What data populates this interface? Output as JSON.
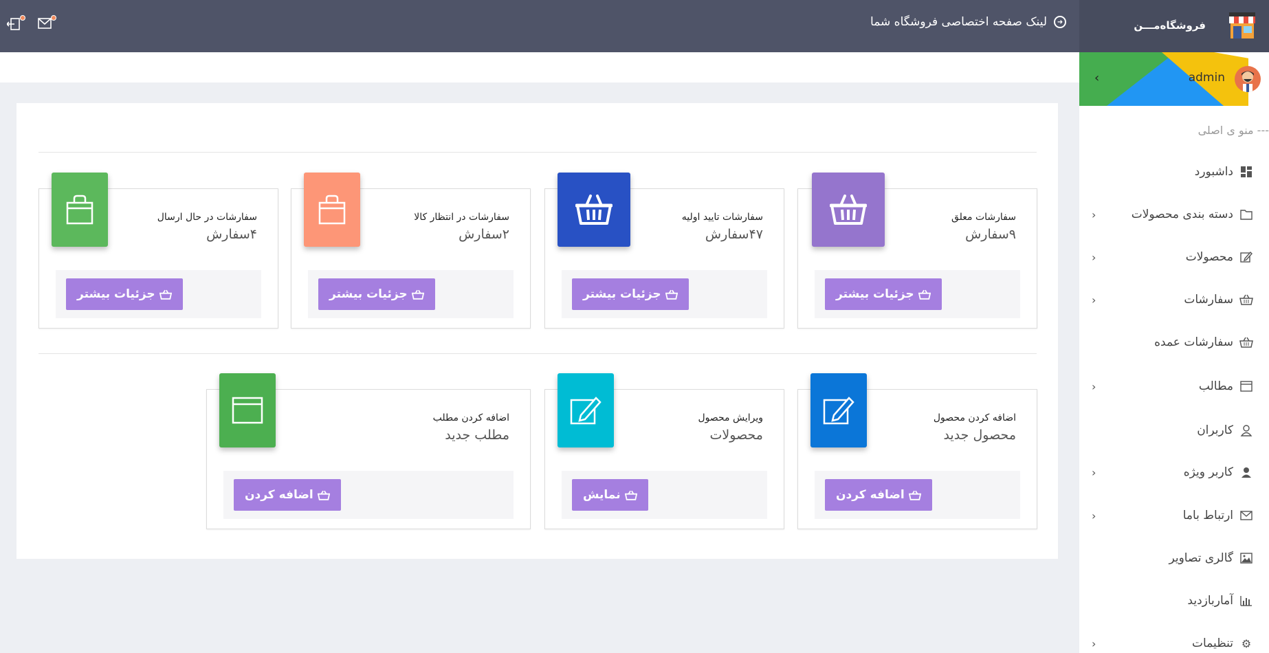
{
  "header": {
    "logo_text": "فروشگاه‌مـــن",
    "store_link_label": "لینک صفحه اختصاصی فروشگاه شما"
  },
  "sidebar": {
    "profile_name": "admin",
    "menu_title": "--- منو ی اصلی",
    "items": [
      {
        "label": "داشبورد",
        "icon": "dashboard-icon",
        "has_children": false
      },
      {
        "label": "دسته بندی محصولات",
        "icon": "folder-icon",
        "has_children": true
      },
      {
        "label": "محصولات",
        "icon": "edit-icon",
        "has_children": true
      },
      {
        "label": "سفارشات",
        "icon": "basket-icon",
        "has_children": true
      },
      {
        "label": "سفارشات عمده",
        "icon": "basket-icon",
        "has_children": false
      },
      {
        "label": "مطالب",
        "icon": "window-icon",
        "has_children": true
      },
      {
        "label": "کاربران",
        "icon": "user-outline-icon",
        "has_children": false
      },
      {
        "label": "کاربر ویژه",
        "icon": "user-icon",
        "has_children": true
      },
      {
        "label": "ارتباط باما",
        "icon": "mail-icon",
        "has_children": true
      },
      {
        "label": "گالری تصاویر",
        "icon": "image-icon",
        "has_children": false
      },
      {
        "label": "آماربازدید",
        "icon": "bar-chart-icon",
        "has_children": false
      },
      {
        "label": "تنظیمات",
        "icon": "gear-icon",
        "has_children": true
      }
    ]
  },
  "cards_row1": [
    {
      "title": "سفارشات معلق",
      "value": "۹سفارش",
      "button": "جزئیات بیشتر",
      "icon": "basket-icon",
      "color": "#9575cd"
    },
    {
      "title": "سفارشات تایید اولیه",
      "value": "۴۷سفارش",
      "button": "جزئیات بیشتر",
      "icon": "basket-icon",
      "color": "#2851c4"
    },
    {
      "title": "سفارشات در انتظار کالا",
      "value": "۲سفارش",
      "button": "جزئیات بیشتر",
      "icon": "bag-icon",
      "color": "#fd9677"
    },
    {
      "title": "سفارشات در حال ارسال",
      "value": "۴سفارش",
      "button": "جزئیات بیشتر",
      "icon": "bag-icon",
      "color": "#5cb85c"
    }
  ],
  "cards_row2": [
    {
      "title": "اضافه کردن محصول",
      "value": "محصول جدید",
      "button": "اضافه کردن",
      "icon": "edit-icon",
      "color": "#0b76d8"
    },
    {
      "title": "ویرایش محصول",
      "value": "محصولات",
      "button": "نمایش",
      "icon": "edit-icon",
      "color": "#00bcd4"
    },
    {
      "title": "اضافه کردن مطلب",
      "value": "مطلب جدید",
      "button": "اضافه کردن",
      "icon": "window-icon",
      "color": "#4caf50"
    }
  ],
  "colors": {
    "topbar": "#4f5468",
    "button": "#a57fe0"
  }
}
